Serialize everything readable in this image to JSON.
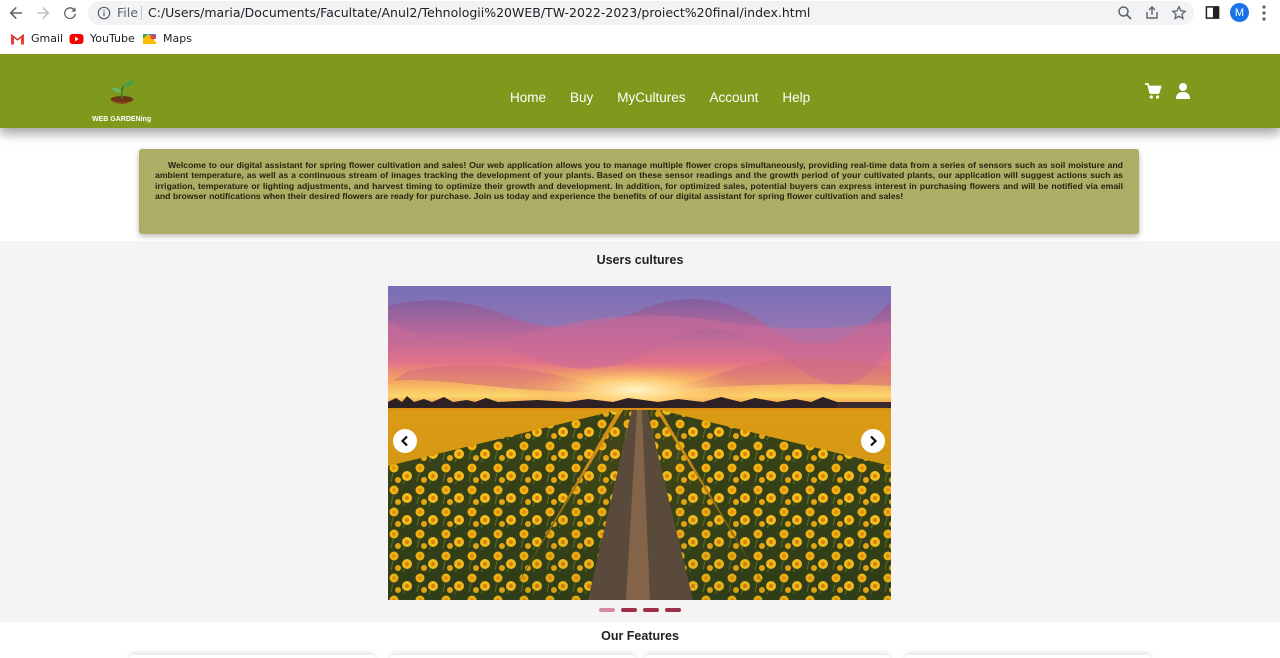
{
  "browser": {
    "file_label": "File",
    "url": "C:/Users/maria/Documents/Facultate/Anul2/Tehnologii%20WEB/TW-2022-2023/proiect%20final/index.html",
    "profile_initial": "M",
    "icons": [
      "back-arrow-icon",
      "forward-arrow-icon",
      "reload-icon",
      "info-icon",
      "zoom-icon",
      "share-icon",
      "star-icon",
      "side-panel-icon",
      "menu-dots-icon"
    ],
    "bookmarks": [
      {
        "label": "Gmail",
        "icon": "gmail-icon"
      },
      {
        "label": "YouTube",
        "icon": "youtube-icon"
      },
      {
        "label": "Maps",
        "icon": "maps-icon"
      }
    ]
  },
  "header": {
    "logo_text": "WEB GARDENing",
    "nav": [
      "Home",
      "Buy",
      "MyCultures",
      "Account",
      "Help"
    ],
    "icons": [
      "cart-icon",
      "user-icon"
    ],
    "background_color": "#7f991c"
  },
  "intro": {
    "text": "Welcome to our digital assistant for spring flower cultivation and sales! Our web application allows you to manage multiple flower crops simultaneously, providing real-time data from a series of sensors such as soil moisture and ambient temperature, as well as a continuous stream of images tracking the development of your plants. Based on these sensor readings and the growth period of your cultivated plants, our application will suggest actions such as irrigation, temperature or lighting adjustments, and harvest timing to optimize their growth and development. In addition, for optimized sales, potential buyers can express interest in purchasing flowers and will be notified via email and browser notifications when their desired flowers are ready for purchase. Join us today and experience the benefits of our digital assistant for spring flower cultivation and sales!",
    "background_color": "#adad65"
  },
  "cultures": {
    "title": "Users cultures",
    "carousel": {
      "image": "daffodil-field-sunset",
      "active_slide": 1,
      "slide_count": 4
    }
  },
  "features": {
    "title": "Our Features"
  }
}
